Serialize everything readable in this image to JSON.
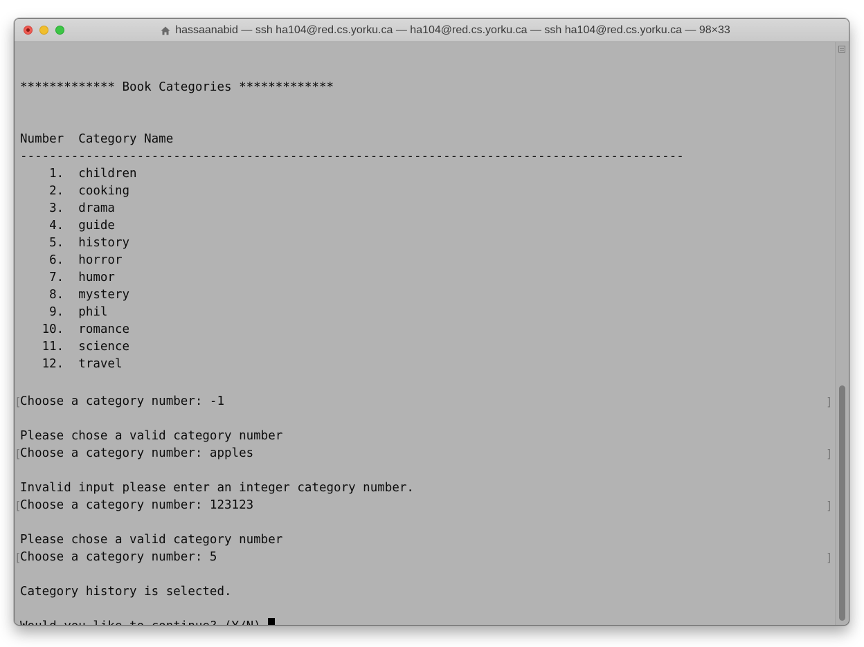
{
  "window": {
    "title": "hassaanabid — ssh ha104@red.cs.yorku.ca — ha104@red.cs.yorku.ca — ssh ha104@red.cs.yorku.ca — 98×33"
  },
  "terminal": {
    "header": "************* Book Categories *************",
    "columns": "Number  Category Name",
    "separator": "-------------------------------------------------------------------------------------------",
    "categories": [
      "    1.  children",
      "    2.  cooking",
      "    3.  drama",
      "    4.  guide",
      "    5.  history",
      "    6.  horror",
      "    7.  humor",
      "    8.  mystery",
      "    9.  phil",
      "   10.  romance",
      "   11.  science",
      "   12.  travel"
    ],
    "session": {
      "prompt1": "Choose a category number: -1",
      "error1": "Please chose a valid category number",
      "prompt2": "Choose a category number: apples",
      "error2": "Invalid input please enter an integer category number.",
      "prompt3": "Choose a category number: 123123",
      "error3": "Please chose a valid category number",
      "prompt4": "Choose a category number: 5",
      "result": "Category history is selected.",
      "continue_prompt": "Would you like to continue? (Y/N) "
    }
  },
  "icons": {
    "title_icon": "home-icon",
    "scroll_button": "split-pane-icon"
  },
  "colors": {
    "terminal_bg": "#b3b3b3",
    "text": "#0d0d0d",
    "close": "#ee5b53",
    "minimize": "#f0be2d",
    "maximize": "#3dc546"
  }
}
